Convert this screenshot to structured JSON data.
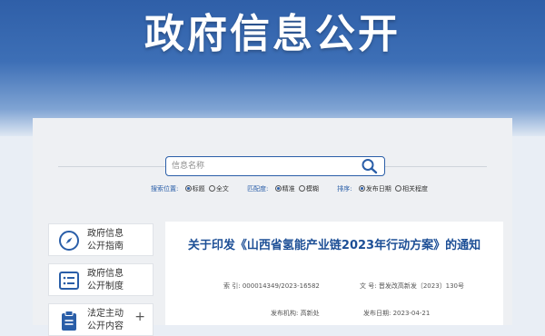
{
  "banner": {
    "title": "政府信息公开"
  },
  "search": {
    "placeholder": "信息名称",
    "groups": [
      {
        "label": "搜索位置:",
        "options": [
          {
            "text": "标题",
            "selected": true
          },
          {
            "text": "全文",
            "selected": false
          }
        ]
      },
      {
        "label": "匹配度:",
        "options": [
          {
            "text": "精准",
            "selected": true
          },
          {
            "text": "模糊",
            "selected": false
          }
        ]
      },
      {
        "label": "排序:",
        "options": [
          {
            "text": "发布日期",
            "selected": true
          },
          {
            "text": "相关程度",
            "selected": false
          }
        ]
      }
    ]
  },
  "sidebar": {
    "items": [
      {
        "line1": "政府信息",
        "line2": "公开指南",
        "icon": "compass-icon"
      },
      {
        "line1": "政府信息",
        "line2": "公开制度",
        "icon": "list-icon"
      },
      {
        "line1": "法定主动",
        "line2": "公开内容",
        "icon": "clipboard-icon",
        "expand": "+"
      }
    ]
  },
  "article": {
    "title": "关于印发《山西省氢能产业链2023年行动方案》的通知",
    "index_label": "索 引:",
    "index_value": "000014349/2023-16582",
    "docno_label": "文 号:",
    "docno_value": "晋发改高新发〔2023〕130号",
    "publisher_label": "发布机构:",
    "publisher_value": "高新处",
    "date_label": "发布日期:",
    "date_value": "2023-04-21"
  },
  "colors": {
    "brand": "#2a5ea8",
    "title": "#1d4f96"
  }
}
